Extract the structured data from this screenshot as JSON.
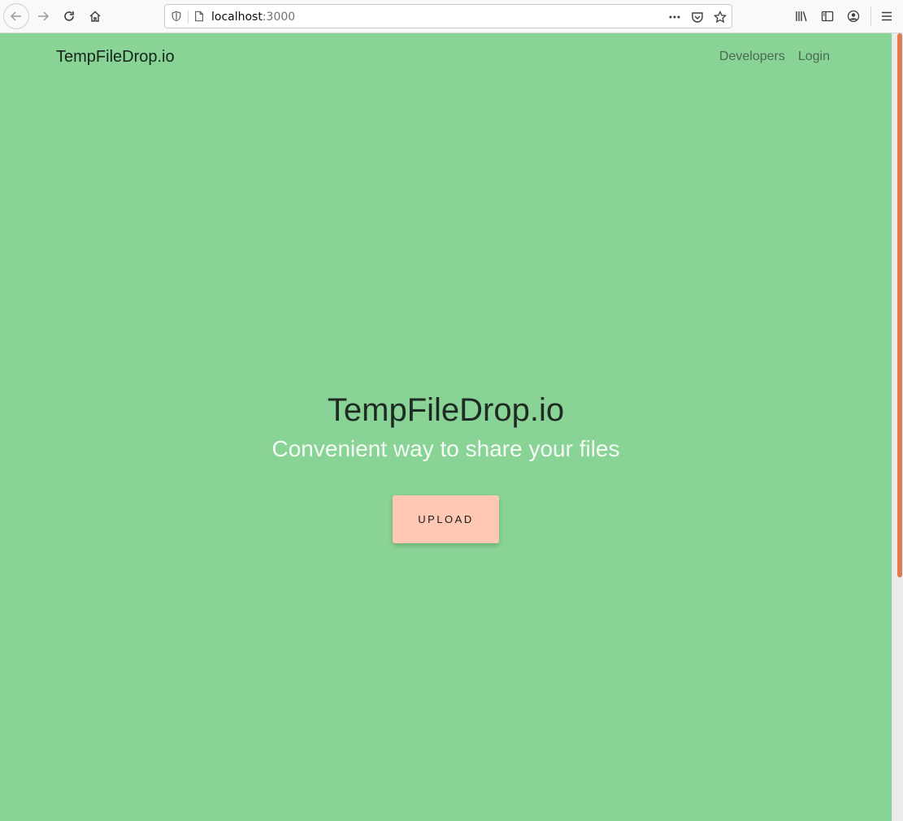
{
  "browser": {
    "url_host": "localhost",
    "url_port": ":3000"
  },
  "page": {
    "brand": "TempFileDrop.io",
    "nav": {
      "developers": "Developers",
      "login": "Login"
    },
    "hero": {
      "title": "TempFileDrop.io",
      "subtitle": "Convenient way to share your files",
      "upload_label": "UPLOAD"
    }
  },
  "colors": {
    "background": "#89d396",
    "upload_button": "#fec8b4",
    "scroll_thumb": "#e07a4f"
  },
  "icons": [
    "back-arrow-icon",
    "forward-arrow-icon",
    "reload-icon",
    "home-icon",
    "shield-icon",
    "page-icon",
    "more-dots-icon",
    "pocket-icon",
    "star-icon",
    "library-icon",
    "sidebar-icon",
    "account-icon",
    "hamburger-menu-icon"
  ]
}
